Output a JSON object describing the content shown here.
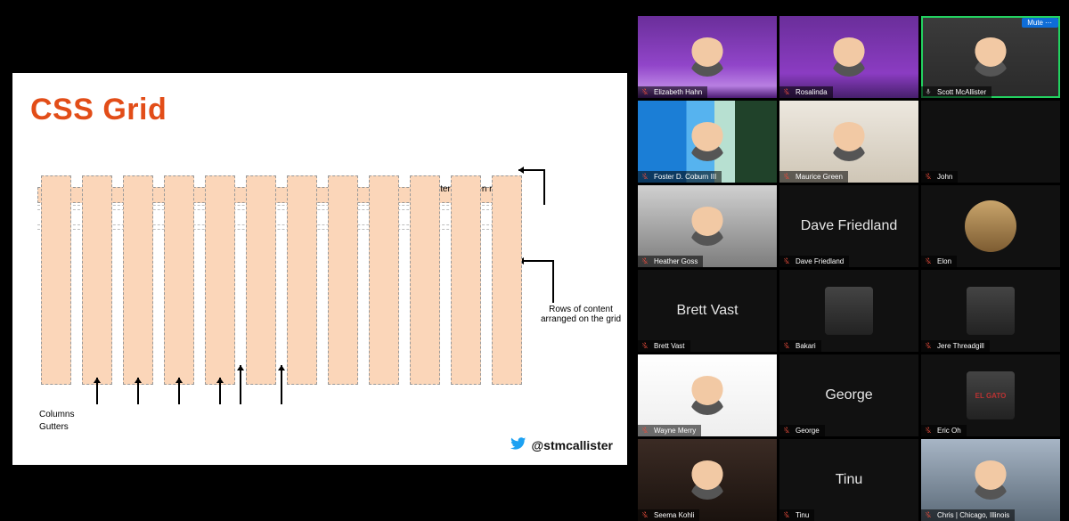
{
  "slide": {
    "title": "CSS Grid",
    "label_gutter_rows": "Gutter between rows",
    "label_rows_content": "Rows of content arranged on the grid",
    "label_columns": "Columns",
    "label_gutters": "Gutters",
    "twitter_handle": "@stmcallister",
    "columns": 12
  },
  "gallery": {
    "mute_btn_label": "Mute",
    "tiles": [
      {
        "name": "Elizabeth Hahn",
        "type": "video",
        "bg": "bg-purple",
        "muted": true,
        "speaking": false
      },
      {
        "name": "Rosalinda",
        "type": "video",
        "bg": "bg-purple2",
        "muted": true,
        "speaking": false
      },
      {
        "name": "Scott McAllister",
        "type": "video",
        "bg": "bg-room",
        "muted": false,
        "speaking": true,
        "show_mute_btn": true
      },
      {
        "name": "Foster D. Coburn III",
        "type": "video",
        "bg": "bg-beach",
        "muted": true,
        "speaking": false
      },
      {
        "name": "Maurice Green",
        "type": "video",
        "bg": "bg-living",
        "muted": true,
        "speaking": false
      },
      {
        "name": "John",
        "type": "off",
        "bg": "bg-dark",
        "muted": true,
        "speaking": false
      },
      {
        "name": "Heather Goss",
        "type": "video",
        "bg": "bg-office",
        "muted": true,
        "speaking": false
      },
      {
        "name": "Dave Friedland",
        "type": "name",
        "bg": "bg-dark",
        "muted": true,
        "speaking": false,
        "big": "Dave Friedland"
      },
      {
        "name": "Elon",
        "type": "avatar-round",
        "bg": "bg-dark",
        "muted": true,
        "avatar_bg": "bg-cars"
      },
      {
        "name": "Brett Vast",
        "type": "name",
        "bg": "bg-dark",
        "muted": true,
        "big": "Brett Vast"
      },
      {
        "name": "Bakari",
        "type": "avatar",
        "bg": "bg-dark",
        "muted": true,
        "avatar_bg": "bg-portrait"
      },
      {
        "name": "Jere Threadgill",
        "type": "avatar",
        "bg": "bg-dark",
        "muted": true,
        "avatar_bg": "bg-cap"
      },
      {
        "name": "Wayne Merry",
        "type": "video",
        "bg": "bg-white",
        "muted": true
      },
      {
        "name": "George",
        "type": "name",
        "bg": "bg-dark",
        "muted": true,
        "big": "George"
      },
      {
        "name": "Eric Oh",
        "type": "avatar",
        "bg": "bg-dark",
        "muted": true,
        "avatar_bg": "bg-truck",
        "caption": "EL GATO"
      },
      {
        "name": "Seema Kohli",
        "type": "video",
        "bg": "bg-portrait",
        "muted": true
      },
      {
        "name": "Tinu",
        "type": "name",
        "bg": "bg-dark",
        "muted": true,
        "big": "Tinu"
      },
      {
        "name": "Chris | Chicago, Illinois",
        "type": "video",
        "bg": "bg-city",
        "muted": true
      }
    ]
  }
}
